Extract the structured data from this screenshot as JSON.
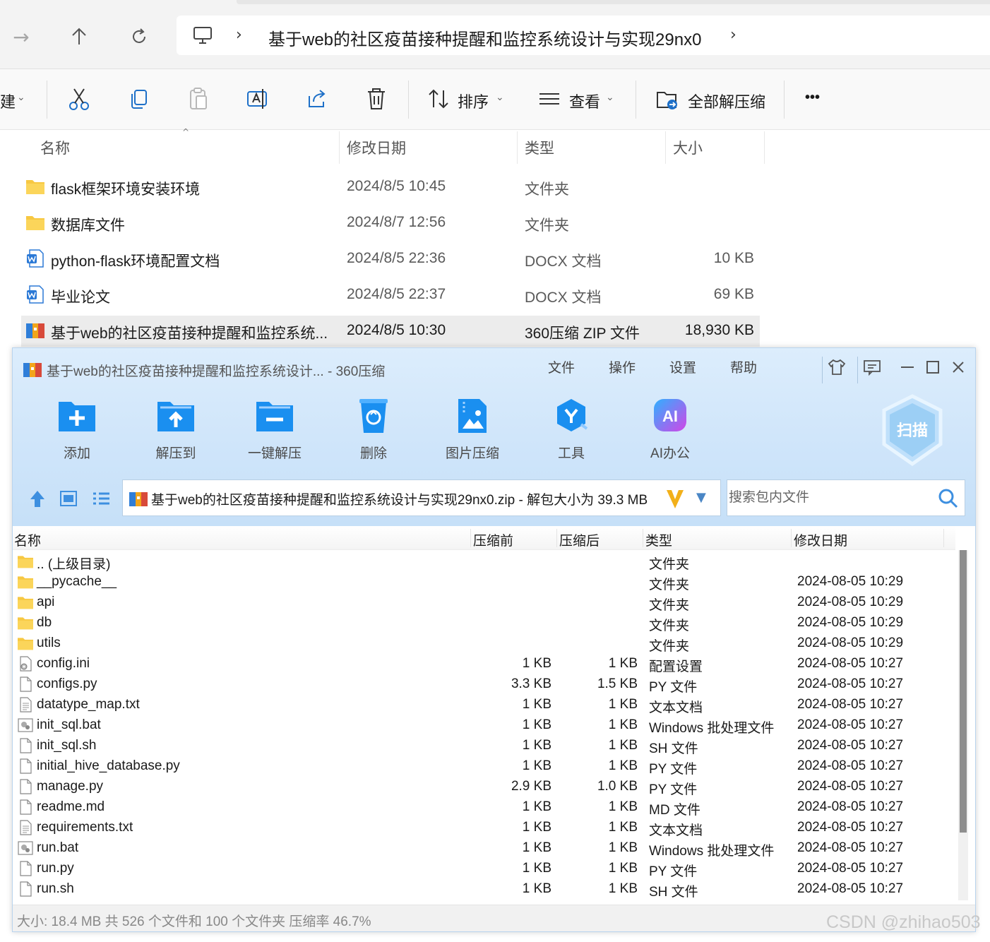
{
  "explorer": {
    "breadcrumb": "基于web的社区疫苗接种提醒和监控系统设计与实现29nx0",
    "toolbar": {
      "new_partial": "建",
      "sort_label": "排序",
      "view_label": "查看",
      "extract_all_label": "全部解压缩",
      "more_label": "•••"
    },
    "columns": {
      "name": "名称",
      "date": "修改日期",
      "type": "类型",
      "size": "大小"
    },
    "files": [
      {
        "name": "flask框架环境安装环境",
        "date": "2024/8/5 10:45",
        "type": "文件夹",
        "size": "",
        "icon": "folder-icon"
      },
      {
        "name": "数据库文件",
        "date": "2024/8/7 12:56",
        "type": "文件夹",
        "size": "",
        "icon": "folder-icon"
      },
      {
        "name": "python-flask环境配置文档",
        "date": "2024/8/5 22:36",
        "type": "DOCX 文档",
        "size": "10 KB",
        "icon": "word-doc-icon"
      },
      {
        "name": "毕业论文",
        "date": "2024/8/5 22:37",
        "type": "DOCX 文档",
        "size": "69 KB",
        "icon": "word-doc-icon"
      },
      {
        "name": "基于web的社区疫苗接种提醒和监控系统...",
        "date": "2024/8/5 10:30",
        "type": "360压缩 ZIP 文件",
        "size": "18,930 KB",
        "icon": "zip-archive-icon",
        "selected": true
      }
    ]
  },
  "zipwin": {
    "title": "基于web的社区疫苗接种提醒和监控系统设计... - 360压缩",
    "menu": [
      "文件",
      "操作",
      "设置",
      "帮助"
    ],
    "tools": [
      "添加",
      "解压到",
      "一键解压",
      "删除",
      "图片压缩",
      "工具",
      "AI办公"
    ],
    "ai_badge": "AI",
    "scan_label": "扫描",
    "path": "基于web的社区疫苗接种提醒和监控系统设计与实现29nx0.zip - 解包大小为 39.3 MB",
    "search_placeholder": "搜索包内文件",
    "columns": {
      "name": "名称",
      "before": "压缩前",
      "after": "压缩后",
      "type": "类型",
      "date": "修改日期"
    },
    "rows": [
      {
        "name": ".. (上级目录)",
        "before": "",
        "after": "",
        "type": "文件夹",
        "date": "",
        "icon": "folder-icon"
      },
      {
        "name": "__pycache__",
        "before": "",
        "after": "",
        "type": "文件夹",
        "date": "2024-08-05 10:29",
        "icon": "folder-icon"
      },
      {
        "name": "api",
        "before": "",
        "after": "",
        "type": "文件夹",
        "date": "2024-08-05 10:29",
        "icon": "folder-icon"
      },
      {
        "name": "db",
        "before": "",
        "after": "",
        "type": "文件夹",
        "date": "2024-08-05 10:29",
        "icon": "folder-icon"
      },
      {
        "name": "utils",
        "before": "",
        "after": "",
        "type": "文件夹",
        "date": "2024-08-05 10:29",
        "icon": "folder-icon"
      },
      {
        "name": "config.ini",
        "before": "1 KB",
        "after": "1 KB",
        "type": "配置设置",
        "date": "2024-08-05 10:27",
        "icon": "settings-file-icon"
      },
      {
        "name": "configs.py",
        "before": "3.3 KB",
        "after": "1.5 KB",
        "type": "PY 文件",
        "date": "2024-08-05 10:27",
        "icon": "file-icon"
      },
      {
        "name": "datatype_map.txt",
        "before": "1 KB",
        "after": "1 KB",
        "type": "文本文档",
        "date": "2024-08-05 10:27",
        "icon": "text-file-icon"
      },
      {
        "name": "init_sql.bat",
        "before": "1 KB",
        "after": "1 KB",
        "type": "Windows 批处理文件",
        "date": "2024-08-05 10:27",
        "icon": "batch-file-icon"
      },
      {
        "name": "init_sql.sh",
        "before": "1 KB",
        "after": "1 KB",
        "type": "SH 文件",
        "date": "2024-08-05 10:27",
        "icon": "file-icon"
      },
      {
        "name": "initial_hive_database.py",
        "before": "1 KB",
        "after": "1 KB",
        "type": "PY 文件",
        "date": "2024-08-05 10:27",
        "icon": "file-icon"
      },
      {
        "name": "manage.py",
        "before": "2.9 KB",
        "after": "1.0 KB",
        "type": "PY 文件",
        "date": "2024-08-05 10:27",
        "icon": "file-icon"
      },
      {
        "name": "readme.md",
        "before": "1 KB",
        "after": "1 KB",
        "type": "MD 文件",
        "date": "2024-08-05 10:27",
        "icon": "file-icon"
      },
      {
        "name": "requirements.txt",
        "before": "1 KB",
        "after": "1 KB",
        "type": "文本文档",
        "date": "2024-08-05 10:27",
        "icon": "text-file-icon"
      },
      {
        "name": "run.bat",
        "before": "1 KB",
        "after": "1 KB",
        "type": "Windows 批处理文件",
        "date": "2024-08-05 10:27",
        "icon": "batch-file-icon"
      },
      {
        "name": "run.py",
        "before": "1 KB",
        "after": "1 KB",
        "type": "PY 文件",
        "date": "2024-08-05 10:27",
        "icon": "file-icon"
      },
      {
        "name": "run.sh",
        "before": "1 KB",
        "after": "1 KB",
        "type": "SH 文件",
        "date": "2024-08-05 10:27",
        "icon": "file-icon"
      }
    ],
    "status": "大小: 18.4 MB 共 526 个文件和 100 个文件夹 压缩率 46.7%"
  },
  "watermark": "CSDN @zhihao503",
  "colors": {
    "folder": "#f7c842",
    "accent_blue": "#1e88e5",
    "zip_bg": "#cfe5fa"
  }
}
